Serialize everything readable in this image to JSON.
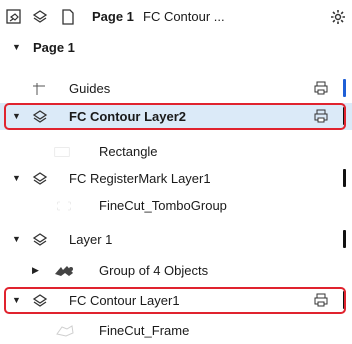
{
  "toolbar": {
    "page_label": "Page 1",
    "doc_label": "FC Contour ...",
    "icons": [
      "layer-options-icon",
      "layers-icon",
      "page-icon",
      "settings-gear-icon"
    ]
  },
  "tree": {
    "page_header": "Page 1",
    "guides": "Guides",
    "fc_contour_layer2": "FC Contour Layer2",
    "rectangle": "Rectangle",
    "fc_registermark_layer1": "FC RegisterMark Layer1",
    "finecut_tombogroup": "FineCut_TomboGroup",
    "layer1": "Layer 1",
    "group_of_objects": "Group of 4 Objects",
    "fc_contour_layer1": "FC Contour Layer1",
    "finecut_frame": "FineCut_Frame"
  },
  "colors": {
    "selection": "#dbeaf8",
    "highlight_border": "#e0232e",
    "guides_color_bar": "#1f5fd6",
    "layer_color_bar": "#111111"
  }
}
